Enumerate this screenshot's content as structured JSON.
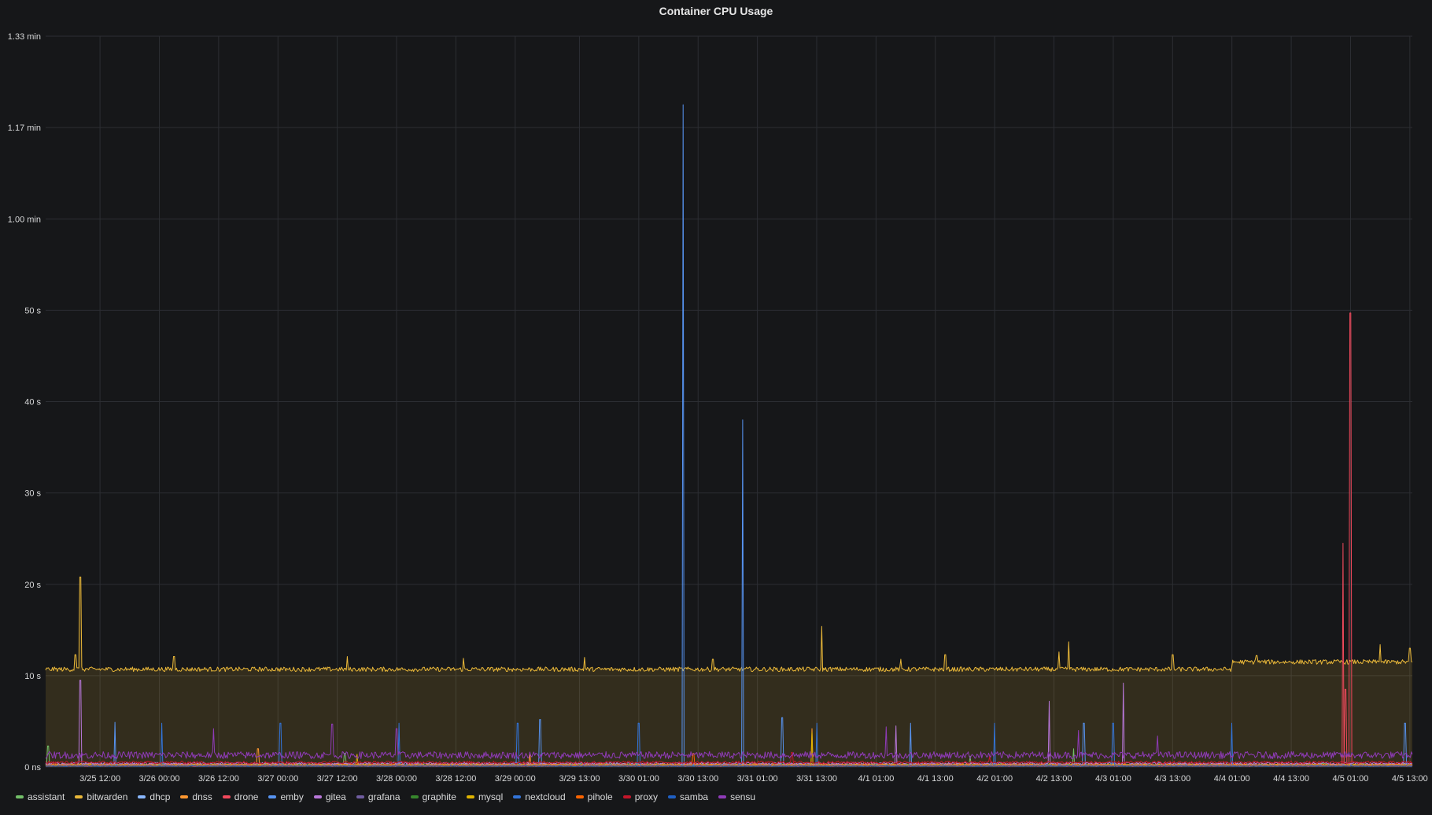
{
  "panel": {
    "title": "Container CPU Usage"
  },
  "chart_data": {
    "type": "line",
    "title": "Container CPU Usage",
    "xlabel": "",
    "ylabel": "",
    "y_unit": "seconds",
    "ylim": [
      0,
      80
    ],
    "y_ticks": [
      {
        "value": 0,
        "label": "0 ns"
      },
      {
        "value": 10,
        "label": "10 s"
      },
      {
        "value": 20,
        "label": "20 s"
      },
      {
        "value": 30,
        "label": "30 s"
      },
      {
        "value": 40,
        "label": "40 s"
      },
      {
        "value": 50,
        "label": "50 s"
      },
      {
        "value": 60,
        "label": "1.00 min"
      },
      {
        "value": 70,
        "label": "1.17 min"
      },
      {
        "value": 80,
        "label": "1.33 min"
      }
    ],
    "x_ticks": [
      "3/25 12:00",
      "3/26 00:00",
      "3/26 12:00",
      "3/27 00:00",
      "3/27 12:00",
      "3/28 00:00",
      "3/28 12:00",
      "3/29 00:00",
      "3/29 13:00",
      "3/30 01:00",
      "3/30 13:00",
      "3/31 01:00",
      "3/31 13:00",
      "4/1 01:00",
      "4/1 13:00",
      "4/2 01:00",
      "4/2 13:00",
      "4/3 01:00",
      "4/3 13:00",
      "4/4 01:00",
      "4/4 13:00",
      "4/5 01:00",
      "4/5 13:00"
    ],
    "x_range": [
      "3/25 01:00",
      "4/5 13:30"
    ],
    "grid": true,
    "legend_placement": "bottom-left",
    "series": [
      {
        "name": "assistant",
        "color": "#73bf69",
        "baseline": 0.3,
        "points": [
          [
            "3/25 01:30",
            2.3
          ],
          [
            "3/27 13:30",
            1.5
          ],
          [
            "4/1 20:00",
            1.2
          ],
          [
            "4/2 17:00",
            2.0
          ]
        ]
      },
      {
        "name": "bitwarden",
        "color": "#eab839",
        "baseline": 10.7,
        "baseline_after": [
          [
            "4/4 01:00",
            11.5
          ]
        ],
        "fill": true,
        "points": [
          [
            "3/25 08:00",
            20.8
          ],
          [
            "3/25 07:00",
            12.3
          ],
          [
            "3/26 03:00",
            12.1
          ],
          [
            "3/27 14:00",
            12.1
          ],
          [
            "3/28 13:30",
            11.9
          ],
          [
            "3/29 14:00",
            12.0
          ],
          [
            "3/30 16:00",
            11.8
          ],
          [
            "3/31 14:00",
            15.4
          ],
          [
            "4/1 06:00",
            11.8
          ],
          [
            "4/1 15:00",
            12.3
          ],
          [
            "4/2 14:00",
            12.6
          ],
          [
            "4/2 16:00",
            13.7
          ],
          [
            "4/3 13:00",
            12.3
          ],
          [
            "4/4 06:00",
            12.2
          ],
          [
            "4/5 07:00",
            13.4
          ],
          [
            "4/5 13:00",
            13.0
          ]
        ]
      },
      {
        "name": "dhcp",
        "color": "#8ab8ff",
        "baseline": 0.2,
        "points": []
      },
      {
        "name": "dnss",
        "color": "#ff9830",
        "baseline": 0.3,
        "points": [
          [
            "3/31 12:00",
            4.2
          ],
          [
            "3/26 20:00",
            2.0
          ],
          [
            "3/29 03:00",
            1.5
          ]
        ]
      },
      {
        "name": "drone",
        "color": "#f2495c",
        "baseline": 0.1,
        "points": [
          [
            "4/5 01:00",
            49.7
          ],
          [
            "4/4 23:30",
            24.5
          ],
          [
            "4/5 00:00",
            8.5
          ]
        ]
      },
      {
        "name": "emby",
        "color": "#5794f2",
        "baseline": 0.2,
        "points": [
          [
            "3/30 10:00",
            72.5
          ],
          [
            "3/30 22:00",
            38.0
          ],
          [
            "3/31 06:00",
            5.4
          ],
          [
            "3/25 15:00",
            4.9
          ],
          [
            "3/29 05:00",
            5.2
          ],
          [
            "4/1 08:00",
            4.8
          ],
          [
            "4/2 19:00",
            4.8
          ],
          [
            "4/5 12:00",
            4.8
          ]
        ]
      },
      {
        "name": "gitea",
        "color": "#b877d9",
        "baseline": 0.4,
        "points": [
          [
            "3/25 08:00",
            9.5
          ],
          [
            "4/2 12:00",
            7.2
          ],
          [
            "4/3 03:00",
            9.2
          ],
          [
            "4/1 05:00",
            4.5
          ]
        ]
      },
      {
        "name": "grafana",
        "color": "#705da0",
        "baseline": 0.2,
        "points": []
      },
      {
        "name": "graphite",
        "color": "#37872d",
        "baseline": 0.2,
        "points": []
      },
      {
        "name": "mysql",
        "color": "#e0b400",
        "baseline": 0.2,
        "points": [
          [
            "3/31 12:00",
            3.8
          ],
          [
            "3/27 16:00",
            1.4
          ]
        ]
      },
      {
        "name": "nextcloud",
        "color": "#3274d9",
        "baseline": 0.2,
        "points": [
          [
            "3/26 00:30",
            4.8
          ],
          [
            "3/27 00:30",
            4.8
          ],
          [
            "3/28 00:30",
            4.8
          ],
          [
            "3/29 00:30",
            4.8
          ],
          [
            "3/30 01:00",
            4.8
          ],
          [
            "3/31 13:00",
            4.8
          ],
          [
            "4/2 01:00",
            4.8
          ],
          [
            "4/3 01:00",
            4.8
          ],
          [
            "4/4 01:00",
            4.8
          ]
        ]
      },
      {
        "name": "pihole",
        "color": "#fa6400",
        "baseline": 0.2,
        "points": [
          [
            "3/30 12:00",
            1.5
          ]
        ]
      },
      {
        "name": "proxy",
        "color": "#c4162a",
        "baseline": 0.5,
        "points": [
          [
            "3/31 08:00",
            1.6
          ],
          [
            "4/2 00:00",
            1.2
          ]
        ]
      },
      {
        "name": "samba",
        "color": "#1f60c4",
        "baseline": 0.1,
        "points": []
      },
      {
        "name": "sensu",
        "color": "#8f3bb8",
        "baseline": 1.3,
        "points": [
          [
            "3/26 11:00",
            4.2
          ],
          [
            "3/27 11:00",
            4.7
          ],
          [
            "3/28 00:00",
            4.2
          ],
          [
            "4/1 03:00",
            4.4
          ],
          [
            "4/2 18:00",
            4.0
          ],
          [
            "4/3 10:00",
            3.4
          ]
        ]
      }
    ]
  }
}
